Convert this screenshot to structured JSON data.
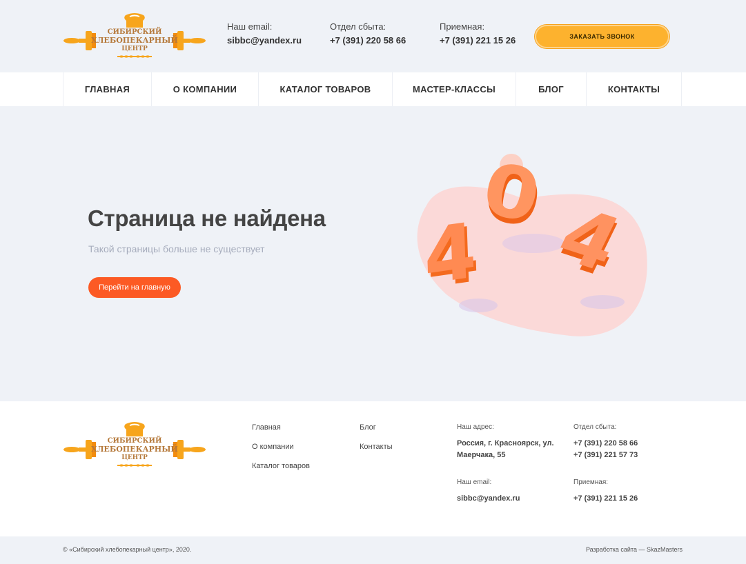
{
  "brand": {
    "line1": "СИБИРСКИЙ",
    "line2": "ХЛЕБОПЕКАРНЫЙ",
    "line3": "ЦЕНТР",
    "colors": {
      "orange": "#f7a51c",
      "brown": "#b5793b"
    }
  },
  "header": {
    "email_label": "Наш email:",
    "email_value": "sibbc@yandex.ru",
    "sales_label": "Отдел сбыта:",
    "sales_value": "+7 (391) 220 58 66",
    "reception_label": "Приемная:",
    "reception_value": "+7 (391) 221 15 26",
    "call_button": "Заказать звонок"
  },
  "nav": {
    "items": [
      {
        "label": "ГЛАВНАЯ"
      },
      {
        "label": "О КОМПАНИИ"
      },
      {
        "label": "КАТАЛОГ ТОВАРОВ"
      },
      {
        "label": "МАСТЕР-КЛАССЫ"
      },
      {
        "label": "БЛОГ"
      },
      {
        "label": "КОНТАКТЫ"
      }
    ]
  },
  "main": {
    "title": "Страница не найдена",
    "subtitle": "Такой страницы больше не существует",
    "home_button": "Перейти на главную",
    "illustration_text": "404"
  },
  "footer": {
    "links_col1": [
      "Главная",
      "О компании",
      "Каталог товаров"
    ],
    "links_col2": [
      "Блог",
      "Контакты"
    ],
    "address_label": "Наш адрес:",
    "address_line1": "Россия, г. Красноярск, ул.",
    "address_line2": "Маерчака, 55",
    "email_label": "Наш email:",
    "email_value": "sibbc@yandex.ru",
    "sales_label": "Отдел сбыта:",
    "sales_phone1": "+7 (391) 220 58 66",
    "sales_phone2": "+7 (391) 221 57 73",
    "reception_label": "Приемная:",
    "reception_value": "+7 (391) 221 15 26",
    "copyright": "© «Сибирский хлебопекарный центр», 2020.",
    "developer": "Разработка сайта — SkazMasters"
  },
  "colors": {
    "accent_orange": "#fc5a24",
    "accent_yellow": "#fdb22e",
    "background": "#eff2f7"
  }
}
